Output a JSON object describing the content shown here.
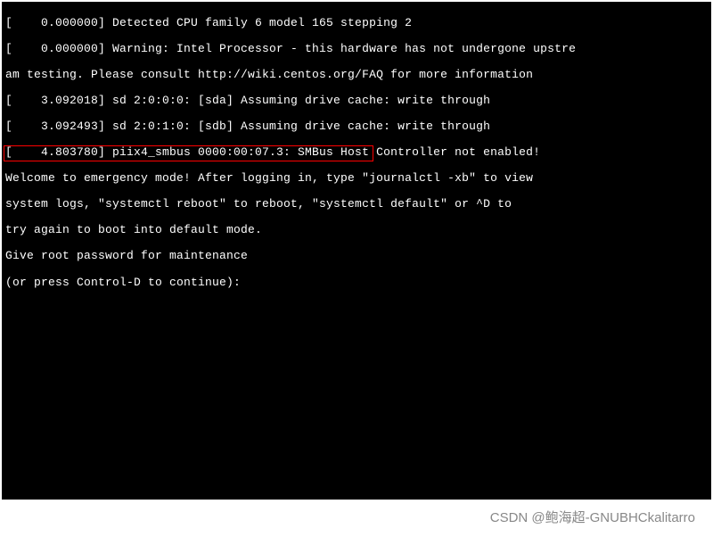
{
  "terminal": {
    "lines": [
      "[    0.000000] Detected CPU family 6 model 165 stepping 2",
      "[    0.000000] Warning: Intel Processor - this hardware has not undergone upstre",
      "am testing. Please consult http://wiki.centos.org/FAQ for more information",
      "[    3.092018] sd 2:0:0:0: [sda] Assuming drive cache: write through",
      "[    3.092493] sd 2:0:1:0: [sdb] Assuming drive cache: write through",
      "[    4.803780] piix4_smbus 0000:00:07.3: SMBus Host Controller not enabled!",
      "Welcome to emergency mode! After logging in, type \"journalctl -xb\" to view",
      "system logs, \"systemctl reboot\" to reboot, \"systemctl default\" or ^D to",
      "try again to boot into default mode.",
      "Give root password for maintenance"
    ],
    "prompt_line": "(or press Control-D to continue): "
  },
  "watermark": "CSDN @鲍海超-GNUBHCkalitarro"
}
